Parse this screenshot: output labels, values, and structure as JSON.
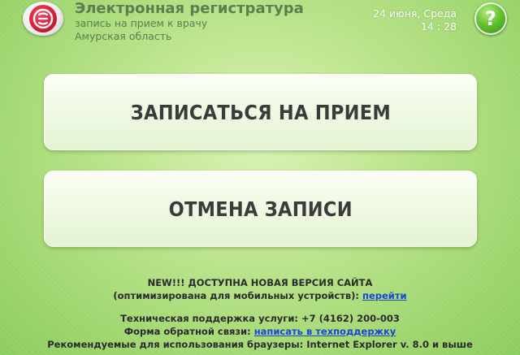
{
  "header": {
    "title": "Электронная регистратура",
    "subtitle": "запись на прием к врачу",
    "region": "Амурская область",
    "date": "24 июня, Среда",
    "time": "14 : 28",
    "help_label": "?",
    "logo_icon": "medical-logo-icon"
  },
  "main": {
    "book_button_label": "ЗАПИСАТЬСЯ НА ПРИЕМ",
    "cancel_button_label": "ОТМЕНА ЗАПИСИ"
  },
  "footer": {
    "new_version_text": "NEW!!! ДОСТУПНА НОВАЯ ВЕРСИЯ САЙТА",
    "optimized_text": "(оптимизирована для мобильных устройств): ",
    "optimized_link": "перейти",
    "support_text": "Техническая поддержка услуги: +7 (4162) 200-003",
    "feedback_text": "Форма обратной связи: ",
    "feedback_link": "написать в техподдержку",
    "browsers_text": "Рекомендуемые для использования браузеры: Internet Explorer v. 8.0 и выше"
  },
  "colors": {
    "background": "#bfe690",
    "link": "#1a45d6",
    "logo_red": "#d61a35",
    "help_green": "#61c12e"
  }
}
